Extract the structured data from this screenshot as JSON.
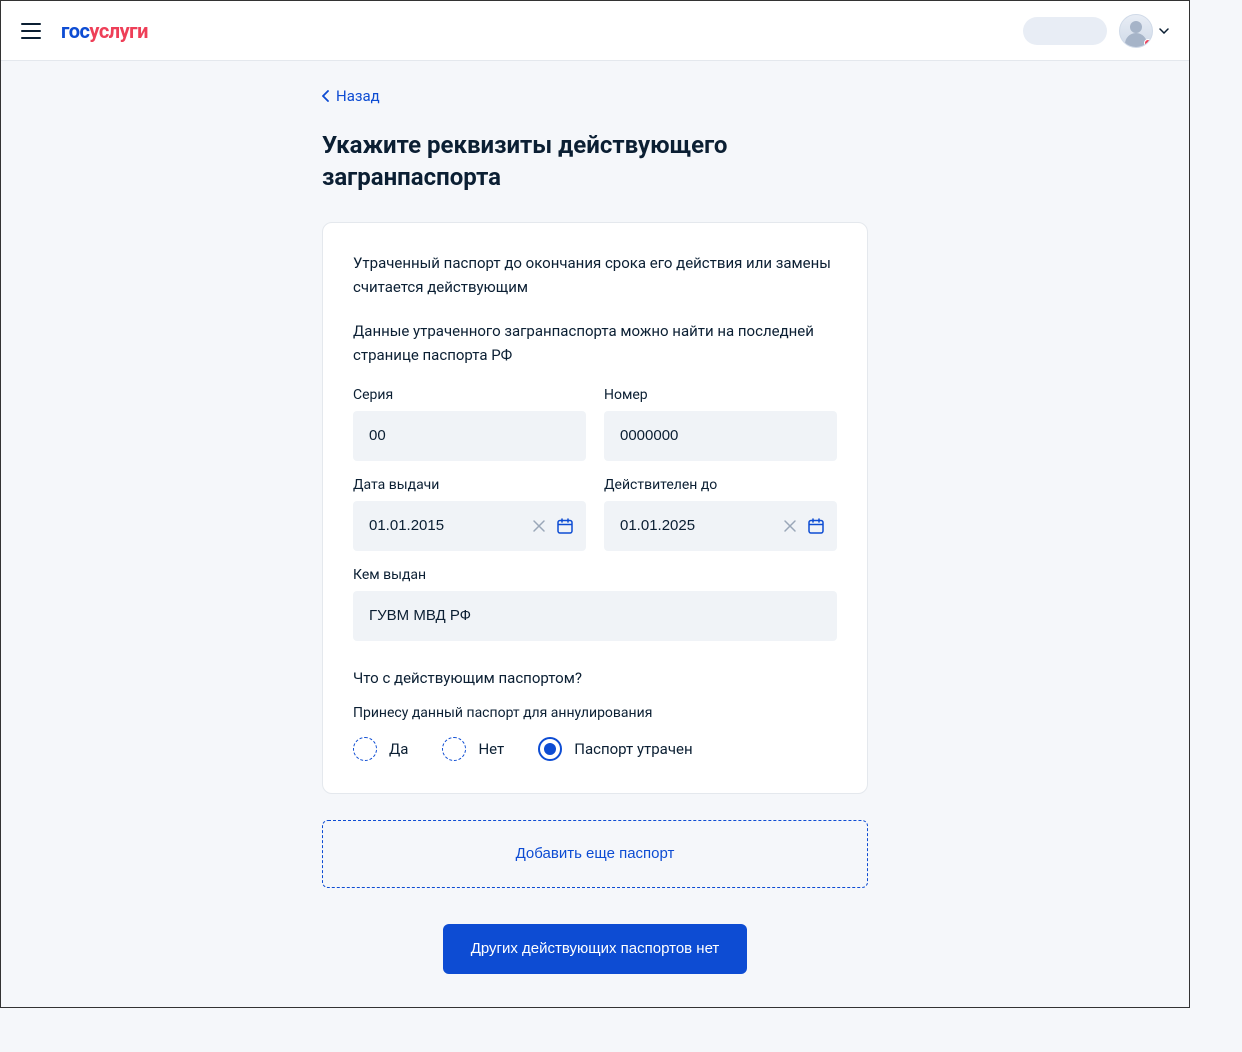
{
  "logo": {
    "part1": "гос",
    "part2": "услуги"
  },
  "back": "Назад",
  "title": "Укажите реквизиты действующего загранпаспорта",
  "info1": "Утраченный паспорт до окончания срока его действия или замены считается действующим",
  "info2": "Данные утраченного загранпаспорта можно найти на последней странице паспорта РФ",
  "fields": {
    "series_label": "Серия",
    "series_value": "00",
    "number_label": "Номер",
    "number_value": "0000000",
    "issue_date_label": "Дата выдачи",
    "issue_date_value": "01.01.2015",
    "valid_until_label": "Действителен до",
    "valid_until_value": "01.01.2025",
    "issued_by_label": "Кем выдан",
    "issued_by_value": "ГУВМ МВД РФ"
  },
  "question": "Что с действующим паспортом?",
  "sub_question": "Принесу данный паспорт для аннулирования",
  "radios": {
    "yes": "Да",
    "no": "Нет",
    "lost": "Паспорт утрачен"
  },
  "add_button": "Добавить еще паспорт",
  "primary_button": "Других действующих паспортов нет"
}
